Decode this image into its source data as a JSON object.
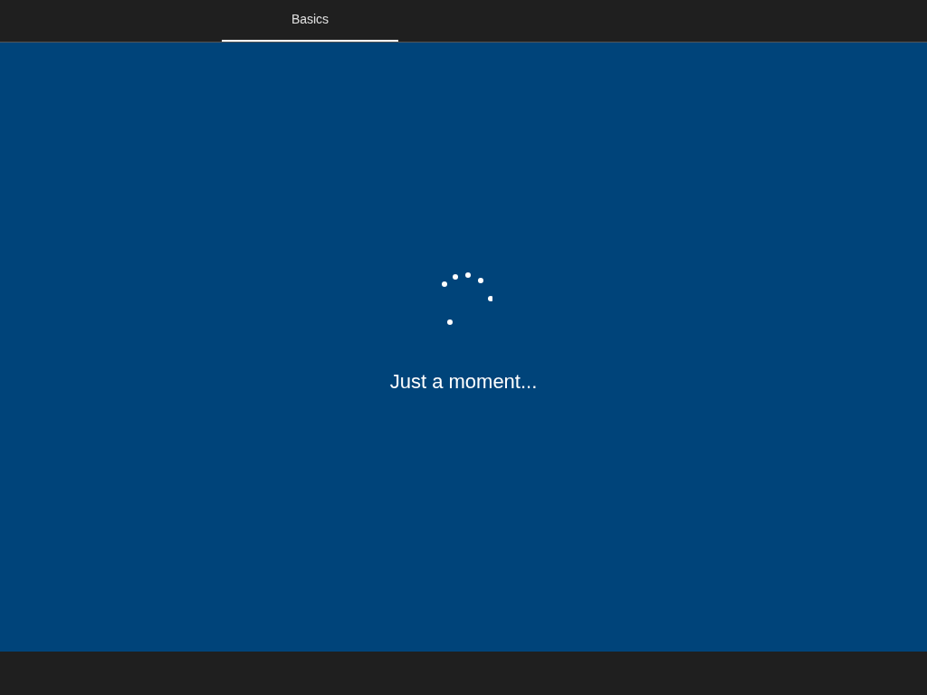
{
  "tabs": [
    {
      "label": "Basics",
      "selected": true
    }
  ],
  "status": {
    "message": "Just a moment..."
  }
}
